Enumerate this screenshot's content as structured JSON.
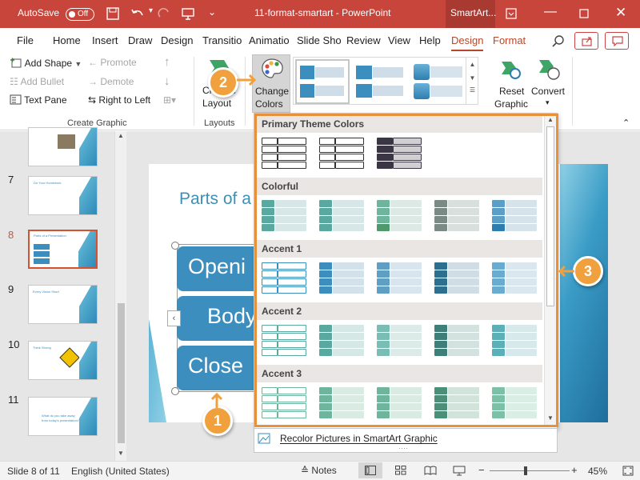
{
  "titlebar": {
    "autosave_label": "AutoSave",
    "autosave_state": "Off",
    "document_title": "11-format-smartart  -  PowerPoint",
    "context_tab": "SmartArt...",
    "window_controls": [
      "minimize-icon",
      "restore-icon",
      "close-icon"
    ]
  },
  "tabs": [
    "File",
    "Home",
    "Insert",
    "Draw",
    "Design",
    "Transitio",
    "Animatio",
    "Slide Sho",
    "Review",
    "View",
    "Help",
    "Design",
    "Format"
  ],
  "ribbon": {
    "create_graphic": {
      "add_shape": "Add Shape",
      "promote": "Promote",
      "add_bullet": "Add Bullet",
      "demote": "Demote",
      "text_pane": "Text Pane",
      "right_to_left": "Right to Left",
      "group_label": "Create Graphic"
    },
    "layouts": {
      "change_layout_line1": "Change",
      "change_layout_line2": "Layout",
      "group_label": "Layouts"
    },
    "change_colors_line1": "Change",
    "change_colors_line2": "Colors",
    "reset": {
      "line1": "Reset",
      "line2": "Graphic"
    },
    "convert": {
      "label": "Convert"
    }
  },
  "slides": [
    {
      "num": "7",
      "text": "Do Your Homework"
    },
    {
      "num": "8",
      "text": "Parts of a Presentation"
    },
    {
      "num": "9",
      "text": "Every Vision Short"
    },
    {
      "num": "10",
      "text": "Think Strong"
    },
    {
      "num": "11",
      "text": "What do you take away from today's presentation?"
    }
  ],
  "slide": {
    "title": "Parts of a",
    "boxes": [
      "Openi",
      "Body",
      "Close"
    ]
  },
  "gallery": {
    "sections": [
      "Primary Theme Colors",
      "Colorful",
      "Accent 1",
      "Accent 2",
      "Accent 3"
    ],
    "recolor": "Recolor Pictures in SmartArt Graphic"
  },
  "statusbar": {
    "slide_info": "Slide 8 of 11",
    "language": "English (United States)",
    "notes": "Notes",
    "zoom": "45%"
  },
  "callouts": [
    "1",
    "2",
    "3"
  ],
  "colors": {
    "titlebar": "#c8453b",
    "accent_tab": "#b7472a",
    "smartart_blue": "#3b8ebd",
    "callout": "#f0a03c",
    "gallery_frame": "#e8913a"
  }
}
